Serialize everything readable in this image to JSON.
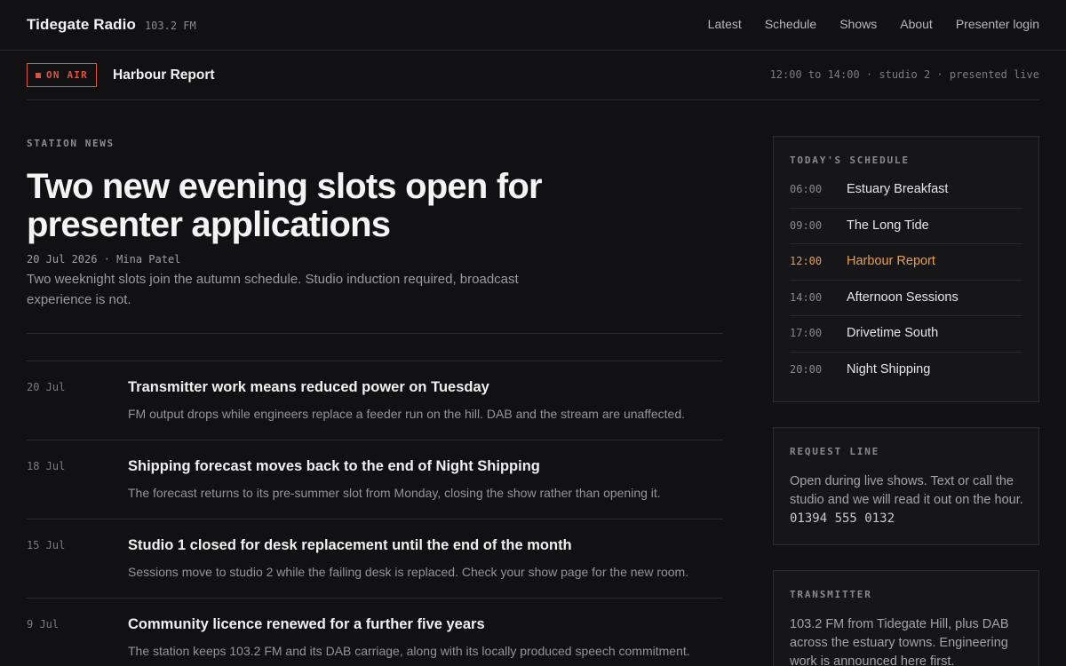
{
  "header": {
    "brand": "Tidegate Radio",
    "frequency": "103.2 FM",
    "nav": [
      "Latest",
      "Schedule",
      "Shows",
      "About",
      "Presenter login"
    ]
  },
  "on_air": {
    "badge": "ON AIR",
    "show": "Harbour Report",
    "meta": "12:00 to 14:00 · studio 2 · presented live",
    "accent": "#e0533a"
  },
  "feature": {
    "kicker": "STATION NEWS",
    "headline": "Two new evening slots open for presenter applications",
    "byline": "20 Jul 2026 · Mina Patel",
    "lede": "Two weeknight slots join the autumn schedule. Studio induction required, broadcast experience is not."
  },
  "news": [
    {
      "date": "20 Jul",
      "title": "Transmitter work means reduced power on Tuesday",
      "body": "FM output drops while engineers replace a feeder run on the hill. DAB and the stream are unaffected."
    },
    {
      "date": "18 Jul",
      "title": "Shipping forecast moves back to the end of Night Shipping",
      "body": "The forecast returns to its pre-summer slot from Monday, closing the show rather than opening it."
    },
    {
      "date": "15 Jul",
      "title": "Studio 1 closed for desk replacement until the end of the month",
      "body": "Sessions move to studio 2 while the failing desk is replaced. Check your show page for the new room."
    },
    {
      "date": "9 Jul",
      "title": "Community licence renewed for a further five years",
      "body": "The station keeps 103.2 FM and its DAB carriage, along with its locally produced speech commitment."
    }
  ],
  "schedule": {
    "title": "TODAY'S SCHEDULE",
    "current_color": "#e7a050",
    "items": [
      {
        "time": "06:00",
        "show": "Estuary Breakfast"
      },
      {
        "time": "09:00",
        "show": "The Long Tide"
      },
      {
        "time": "12:00",
        "show": "Harbour Report"
      },
      {
        "time": "14:00",
        "show": "Afternoon Sessions"
      },
      {
        "time": "17:00",
        "show": "Drivetime South"
      },
      {
        "time": "20:00",
        "show": "Night Shipping"
      }
    ]
  },
  "request_line": {
    "title": "REQUEST LINE",
    "text": "Open during live shows. Text or call the studio and we will read it out on the hour.",
    "phone": "01394 555 0132"
  },
  "transmitter": {
    "title": "TRANSMITTER",
    "text": "103.2 FM from Tidegate Hill, plus DAB across the estuary towns. Engineering work is announced here first."
  }
}
